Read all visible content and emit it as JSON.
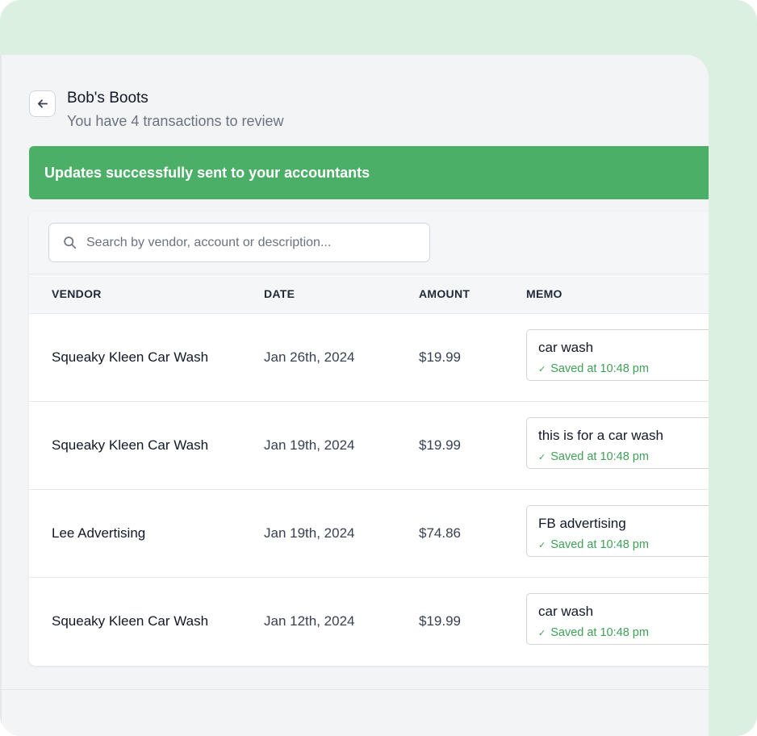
{
  "header": {
    "title": "Bob's Boots",
    "subtitle": "You have 4 transactions to review"
  },
  "banner": {
    "message": "Updates successfully sent to your accountants"
  },
  "search": {
    "placeholder": "Search by vendor, account or description...",
    "value": ""
  },
  "table": {
    "columns": {
      "vendor": "VENDOR",
      "date": "DATE",
      "amount": "AMOUNT",
      "memo": "MEMO"
    },
    "rows": [
      {
        "vendor": "Squeaky Kleen Car Wash",
        "date": "Jan 26th, 2024",
        "amount": "$19.99",
        "memo": "car wash",
        "status": "Saved at 10:48 pm"
      },
      {
        "vendor": "Squeaky Kleen Car Wash",
        "date": "Jan 19th, 2024",
        "amount": "$19.99",
        "memo": "this is for a car wash",
        "status": "Saved at 10:48 pm"
      },
      {
        "vendor": "Lee Advertising",
        "date": "Jan 19th, 2024",
        "amount": "$74.86",
        "memo": "FB advertising",
        "status": "Saved at 10:48 pm"
      },
      {
        "vendor": "Squeaky Kleen Car Wash",
        "date": "Jan 12th, 2024",
        "amount": "$19.99",
        "memo": "car wash",
        "status": "Saved at 10:48 pm"
      }
    ]
  },
  "icons": {
    "back": "arrow-left-icon",
    "search": "search-icon",
    "check": "check-icon"
  },
  "colors": {
    "accent_green": "#4caf68",
    "saved_green": "#3f9f56",
    "frame_green": "#dcf0e2"
  }
}
